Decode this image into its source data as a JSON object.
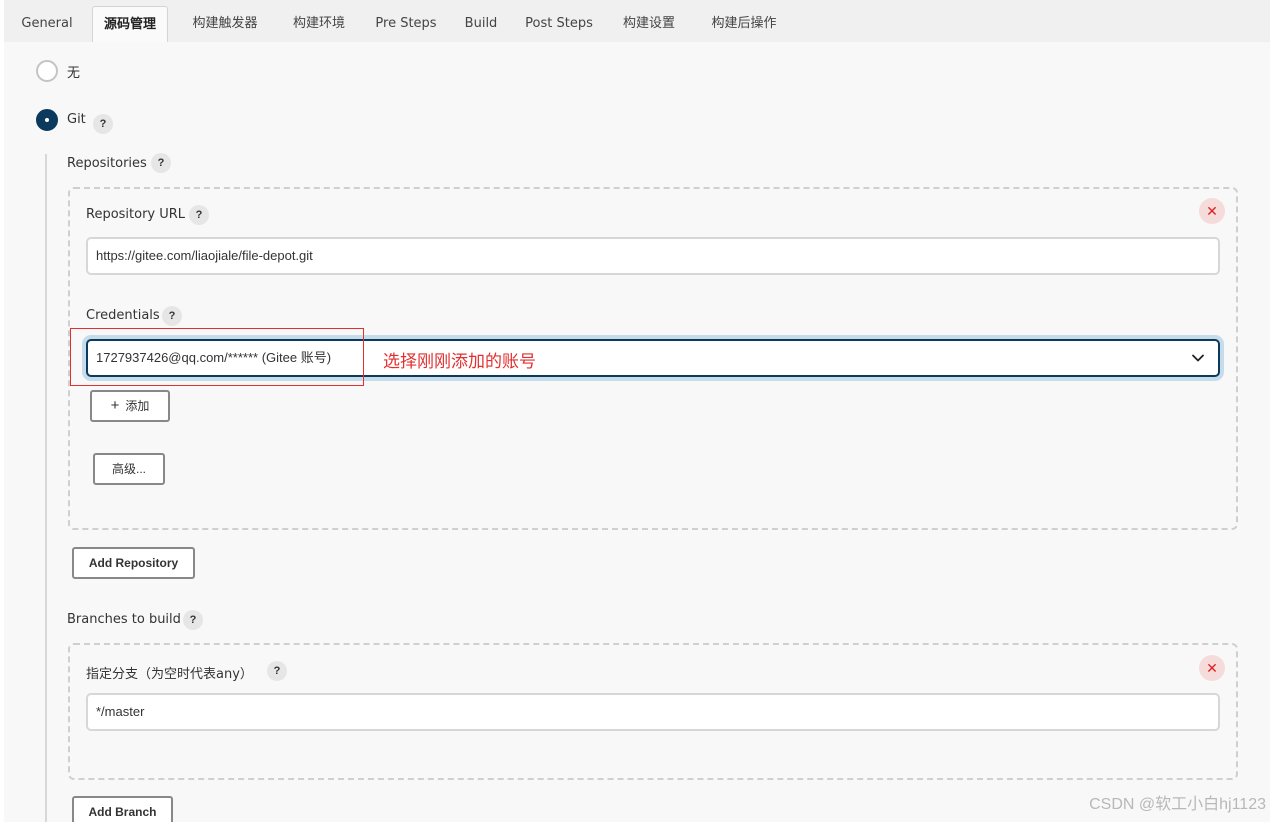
{
  "tabs": [
    "General",
    "源码管理",
    "构建触发器",
    "构建环境",
    "Pre Steps",
    "Build",
    "Post Steps",
    "构建设置",
    "构建后操作"
  ],
  "scm": {
    "none_label": "无",
    "git_label": "Git",
    "help_glyph": "?"
  },
  "repositories": {
    "label": "Repositories",
    "url_label": "Repository URL",
    "url_value": "https://gitee.com/liaojiale/file-depot.git",
    "credentials_label": "Credentials",
    "credentials_selected": "1727937426@qq.com/****** (Gitee 账号)",
    "add_label": "添加",
    "advanced_label": "高级...",
    "add_repository_label": "Add Repository",
    "delete_glyph": "✕"
  },
  "annotation": "选择刚刚添加的账号",
  "branches": {
    "label": "Branches to build",
    "specifier_label": "指定分支（为空时代表any）",
    "specifier_value": "*/master",
    "add_branch_label": "Add Branch"
  },
  "watermark": "CSDN @软工小白hj1123",
  "colors": {
    "accent": "#0b3a5c",
    "annotation": "#e23030",
    "delete": "#d22222"
  }
}
